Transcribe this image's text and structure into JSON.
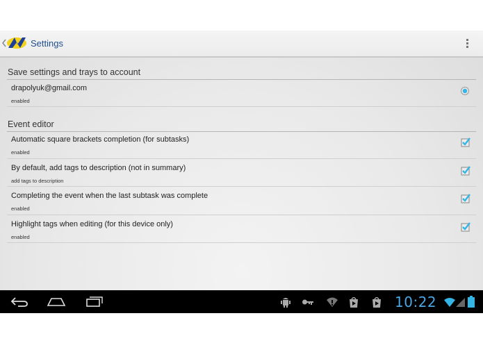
{
  "action_bar": {
    "title": "Settings",
    "logo_icon": "app-logo-icon",
    "menu_icon": "overflow-menu-icon"
  },
  "sections": [
    {
      "header": "Save settings and trays to account",
      "items": [
        {
          "title": "drapolyuk@gmail.com",
          "summary": "enabled",
          "control": "radio",
          "checked": true
        }
      ]
    },
    {
      "header": "Event editor",
      "items": [
        {
          "title": "Automatic square brackets completion (for subtasks)",
          "summary": "enabled",
          "control": "checkbox",
          "checked": true
        },
        {
          "title": "By default, add tags to description (not in summary)",
          "summary": "add tags to description",
          "control": "checkbox",
          "checked": true
        },
        {
          "title": "Completing the event when the last subtask was complete",
          "summary": "enabled",
          "control": "checkbox",
          "checked": true
        },
        {
          "title": "Highlight tags when editing (for this device only)",
          "summary": "enabled",
          "control": "checkbox",
          "checked": true
        }
      ]
    }
  ],
  "system_bar": {
    "clock": "10:22",
    "nav_icons": [
      "back-icon",
      "home-icon",
      "recent-apps-icon"
    ],
    "notification_icons": [
      "android-debug-icon",
      "key-icon",
      "wifi-alert-icon",
      "play-store-icon",
      "play-store-icon"
    ],
    "status_icons": [
      "wifi-icon",
      "signal-icon",
      "battery-icon"
    ]
  },
  "colors": {
    "accent": "#33b5e5",
    "title_blue": "#1f4e8c",
    "clock_blue": "#4aa6e3"
  }
}
